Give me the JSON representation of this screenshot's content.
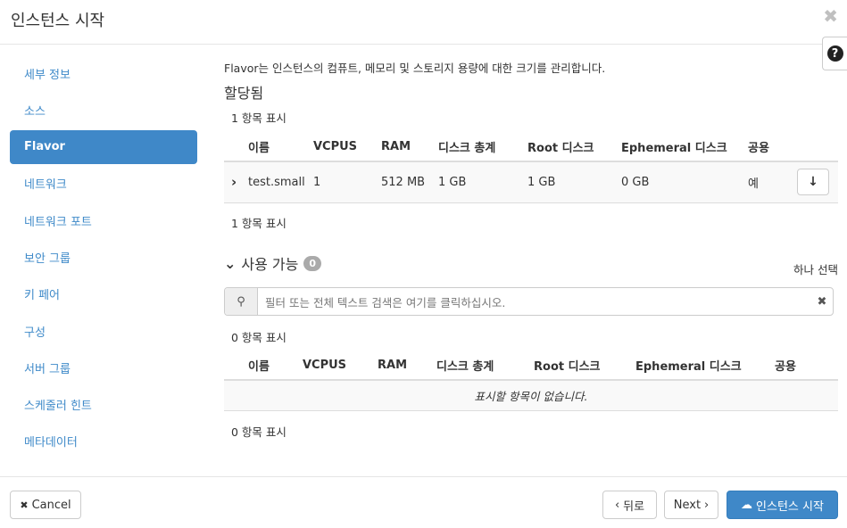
{
  "header": {
    "title": "인스턴스 시작",
    "close_symbol": "✖",
    "help_symbol": "?"
  },
  "sidebar": {
    "items": [
      {
        "label": "세부 정보"
      },
      {
        "label": "소스"
      },
      {
        "label": "Flavor"
      },
      {
        "label": "네트워크"
      },
      {
        "label": "네트워크 포트"
      },
      {
        "label": "보안 그룹"
      },
      {
        "label": "키 페어"
      },
      {
        "label": "구성"
      },
      {
        "label": "서버 그룹"
      },
      {
        "label": "스케줄러 힌트"
      },
      {
        "label": "메타데이터"
      }
    ],
    "active_index": 2
  },
  "main": {
    "description": "Flavor는 인스턴스의 컴퓨트, 메모리 및 스토리지 용량에 대한 크기를 관리합니다.",
    "allocated": {
      "title": "할당됨",
      "count_top": "1 항목 표시",
      "count_bottom": "1 항목 표시",
      "columns": [
        "이름",
        "VCPUS",
        "RAM",
        "디스크 총계",
        "Root 디스크",
        "Ephemeral 디스크",
        "공용"
      ],
      "row": {
        "expand_symbol": "›",
        "name": "test.small",
        "vcpus": "1",
        "ram": "512 MB",
        "disk_total": "1 GB",
        "root_disk": "1 GB",
        "ephemeral_disk": "0 GB",
        "public": "예",
        "action_symbol": "↓"
      }
    },
    "available": {
      "title": "사용 가능",
      "toggle_symbol": "⌄",
      "badge": "0",
      "select_one": "하나 선택",
      "filter_placeholder": "필터 또는 전체 텍스트 검색은 여기를 클릭하십시오.",
      "search_symbol": "⚲",
      "clear_symbol": "✖",
      "count_top": "0 항목 표시",
      "count_bottom": "0 항목 표시",
      "columns": [
        "이름",
        "VCPUS",
        "RAM",
        "디스크 총계",
        "Root 디스크",
        "Ephemeral 디스크",
        "공용"
      ],
      "empty_message": "표시할 항목이 없습니다."
    }
  },
  "footer": {
    "cancel_label": "Cancel",
    "cancel_symbol": "✖",
    "back_label": "뒤로",
    "back_symbol": "‹",
    "next_label": "Next",
    "next_symbol": "›",
    "launch_label": "인스턴스 시작",
    "launch_symbol": "☁"
  },
  "colors": {
    "accent": "#3f88c8",
    "link": "#3f8ac9",
    "badge": "#aaaaaa"
  }
}
